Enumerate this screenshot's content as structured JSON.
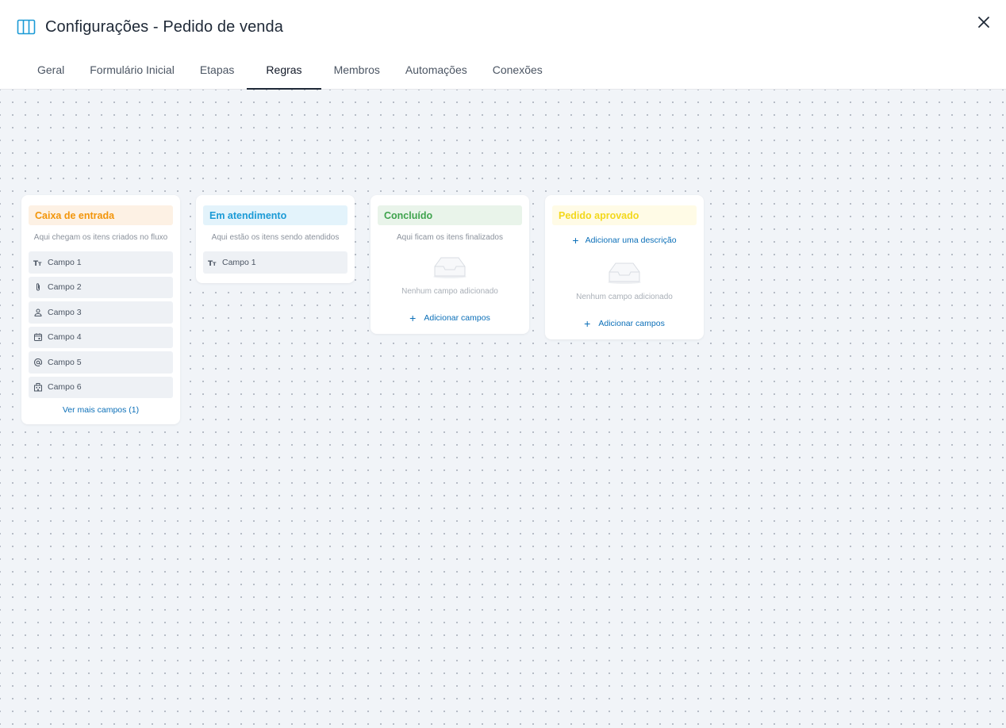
{
  "window": {
    "title": "Configurações - Pedido de venda",
    "icon": "kanban-columns-icon",
    "close_icon": "close-icon"
  },
  "tabs": [
    {
      "label": "Geral",
      "active": false
    },
    {
      "label": "Formulário Inicial",
      "active": false
    },
    {
      "label": "Etapas",
      "active": false
    },
    {
      "label": "Regras",
      "active": true
    },
    {
      "label": "Membros",
      "active": false
    },
    {
      "label": "Automações",
      "active": false
    },
    {
      "label": "Conexões",
      "active": false
    }
  ],
  "colors": {
    "accent": "#1a9ad6",
    "link": "#0b6fb8",
    "canvas_bg": "#f1f4f8"
  },
  "phases": [
    {
      "title": "Caixa de entrada",
      "title_color": "#f2950b",
      "title_bg": "#fdf1e4",
      "description": "Aqui chegam os itens criados no fluxo",
      "fields": [
        {
          "label": "Campo 1",
          "icon": "text-type-icon"
        },
        {
          "label": "Campo 2",
          "icon": "attachment-icon"
        },
        {
          "label": "Campo 3",
          "icon": "user-icon"
        },
        {
          "label": "Campo 4",
          "icon": "calendar-icon"
        },
        {
          "label": "Campo 5",
          "icon": "at-sign-icon"
        },
        {
          "label": "Campo 6",
          "icon": "building-icon"
        }
      ],
      "more_fields": "Ver mais campos (1)"
    },
    {
      "title": "Em atendimento",
      "title_color": "#1a9ad6",
      "title_bg": "#e3f3fb",
      "description": "Aqui estão os itens sendo atendidos",
      "fields": [
        {
          "label": "Campo 1",
          "icon": "text-type-icon"
        }
      ]
    },
    {
      "title": "Concluído",
      "title_color": "#3fa34d",
      "title_bg": "#e9f4ea",
      "description": "Aqui ficam os itens finalizados",
      "empty_text": "Nenhum campo adicionado",
      "add_fields": "Adicionar campos"
    },
    {
      "title": "Pedido aprovado",
      "title_color": "#f3d81c",
      "title_bg": "#fffbe6",
      "add_description": "Adicionar uma descrição",
      "empty_text": "Nenhum campo adicionado",
      "add_fields": "Adicionar campos"
    }
  ]
}
